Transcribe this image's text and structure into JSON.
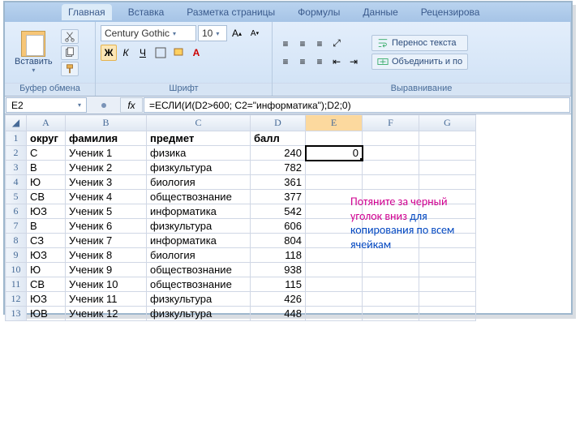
{
  "tabs": [
    "Главная",
    "Вставка",
    "Разметка страницы",
    "Формулы",
    "Данные",
    "Рецензирова"
  ],
  "paste_label": "Вставить",
  "font_name": "Century Gothic",
  "font_size": "10",
  "bold": "Ж",
  "italic": "К",
  "underline": "Ч",
  "group_clipboard": "Буфер обмена",
  "group_font": "Шрифт",
  "group_align": "Выравнивание",
  "wrap_text": "Перенос текста",
  "merge": "Объединить и по",
  "active_cell": "E2",
  "fx": "fx",
  "formula": "=ЕСЛИ(И(D2>600; C2=\"информатика\");D2;0)",
  "columns": [
    "A",
    "B",
    "C",
    "D",
    "E",
    "F",
    "G"
  ],
  "headers": {
    "A": "округ",
    "B": "фамилия",
    "C": "предмет",
    "D": "балл"
  },
  "e2_value": "0",
  "rows": [
    {
      "n": 2,
      "a": "С",
      "b": "Ученик 1",
      "c": "физика",
      "d": 240
    },
    {
      "n": 3,
      "a": "В",
      "b": "Ученик 2",
      "c": "физкультура",
      "d": 782
    },
    {
      "n": 4,
      "a": "Ю",
      "b": "Ученик 3",
      "c": "биология",
      "d": 361
    },
    {
      "n": 5,
      "a": "СВ",
      "b": "Ученик 4",
      "c": "обществознание",
      "d": 377
    },
    {
      "n": 6,
      "a": "ЮЗ",
      "b": "Ученик 5",
      "c": "информатика",
      "d": 542
    },
    {
      "n": 7,
      "a": "В",
      "b": "Ученик 6",
      "c": "физкультура",
      "d": 606
    },
    {
      "n": 8,
      "a": "СЗ",
      "b": "Ученик 7",
      "c": "информатика",
      "d": 804
    },
    {
      "n": 9,
      "a": "ЮЗ",
      "b": "Ученик 8",
      "c": "биология",
      "d": 118
    },
    {
      "n": 10,
      "a": "Ю",
      "b": "Ученик 9",
      "c": "обществознание",
      "d": 938
    },
    {
      "n": 11,
      "a": "СВ",
      "b": "Ученик 10",
      "c": "обществознание",
      "d": 115
    },
    {
      "n": 12,
      "a": "ЮЗ",
      "b": "Ученик 11",
      "c": "физкультура",
      "d": 426
    },
    {
      "n": 13,
      "a": "ЮВ",
      "b": "Ученик 12",
      "c": "физкультура",
      "d": 448
    }
  ],
  "annotation": {
    "line1": "Потяните за черный уголок вниз ",
    "line2": "для копирования по всем ячейкам"
  }
}
